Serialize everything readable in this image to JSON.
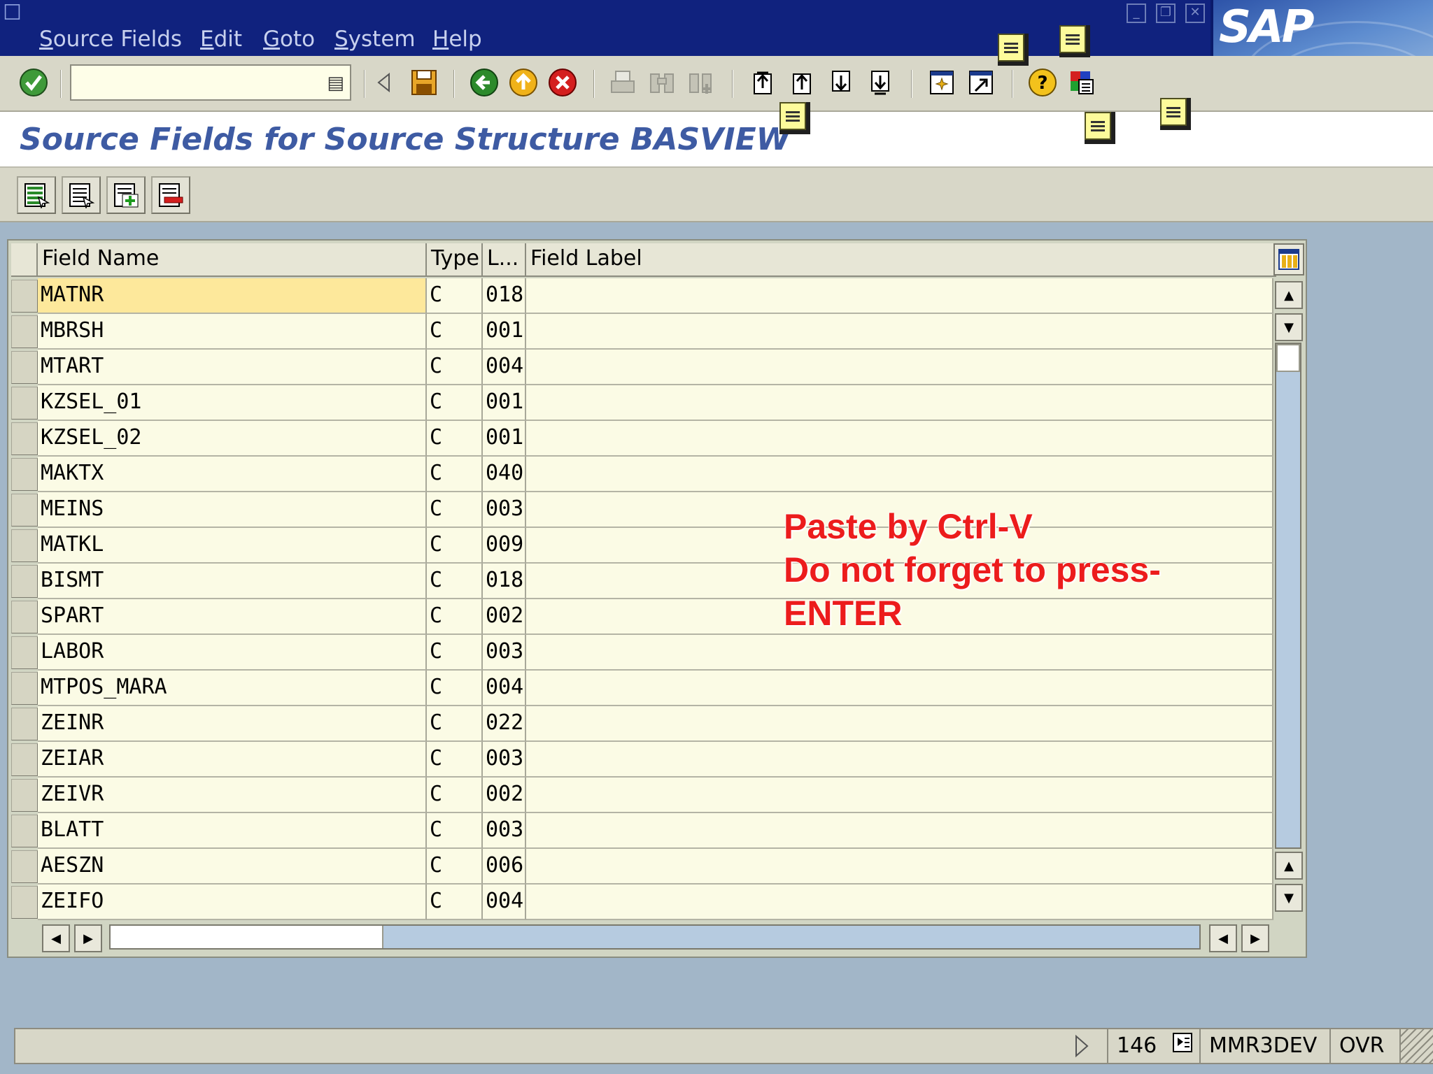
{
  "menu": {
    "items": [
      "Source Fields",
      "Edit",
      "Goto",
      "System",
      "Help"
    ]
  },
  "logo_text": "SAP",
  "toolbar": {
    "command_value": "",
    "icons": {
      "enter": "check-circle-icon",
      "command_dropdown": "history-list-icon",
      "save": "floppy-disk-icon",
      "back": "back-arrow-icon",
      "exit": "exit-up-icon",
      "cancel": "cancel-x-icon",
      "print": "print-icon",
      "find": "find-icon",
      "find_next": "find-next-icon",
      "first_page": "first-page-icon",
      "prev_page": "previous-page-icon",
      "next_page": "next-page-icon",
      "last_page": "last-page-icon",
      "new_session": "new-session-icon",
      "shortcut": "shortcut-icon",
      "help": "help-icon",
      "layout": "customize-layout-icon"
    }
  },
  "page_title": "Source Fields for Source Structure BASVIEW",
  "app_toolbar": {
    "icons": [
      "select-all-icon",
      "deselect-all-icon",
      "insert-row-icon",
      "delete-row-icon"
    ]
  },
  "table": {
    "columns": [
      "Field Name",
      "Type",
      "L...",
      "Field Label"
    ],
    "rows": [
      {
        "name": "MATNR",
        "type": "C",
        "length": "018",
        "label": ""
      },
      {
        "name": "MBRSH",
        "type": "C",
        "length": "001",
        "label": ""
      },
      {
        "name": "MTART",
        "type": "C",
        "length": "004",
        "label": ""
      },
      {
        "name": "KZSEL_01",
        "type": "C",
        "length": "001",
        "label": ""
      },
      {
        "name": "KZSEL_02",
        "type": "C",
        "length": "001",
        "label": ""
      },
      {
        "name": "MAKTX",
        "type": "C",
        "length": "040",
        "label": ""
      },
      {
        "name": "MEINS",
        "type": "C",
        "length": "003",
        "label": ""
      },
      {
        "name": "MATKL",
        "type": "C",
        "length": "009",
        "label": ""
      },
      {
        "name": "BISMT",
        "type": "C",
        "length": "018",
        "label": ""
      },
      {
        "name": "SPART",
        "type": "C",
        "length": "002",
        "label": ""
      },
      {
        "name": "LABOR",
        "type": "C",
        "length": "003",
        "label": ""
      },
      {
        "name": "MTPOS_MARA",
        "type": "C",
        "length": "004",
        "label": ""
      },
      {
        "name": "ZEINR",
        "type": "C",
        "length": "022",
        "label": ""
      },
      {
        "name": "ZEIAR",
        "type": "C",
        "length": "003",
        "label": ""
      },
      {
        "name": "ZEIVR",
        "type": "C",
        "length": "002",
        "label": ""
      },
      {
        "name": "BLATT",
        "type": "C",
        "length": "003",
        "label": ""
      },
      {
        "name": "AESZN",
        "type": "C",
        "length": "006",
        "label": ""
      },
      {
        "name": "ZEIFO",
        "type": "C",
        "length": "004",
        "label": ""
      }
    ],
    "focused_row": 0
  },
  "annotation": {
    "lines": [
      "Paste by Ctrl-V",
      "Do not forget to press-",
      "ENTER"
    ],
    "color": "#ec1c1c"
  },
  "statusbar": {
    "session_number": "146",
    "system": "MMR3DEV",
    "mode": "OVR"
  },
  "colors": {
    "menubar": "#10227e",
    "title": "#3e5ba3",
    "cell_bg": "#fbfbe5",
    "focus_cell": "#fde89b",
    "background": "#a2b6c8"
  }
}
